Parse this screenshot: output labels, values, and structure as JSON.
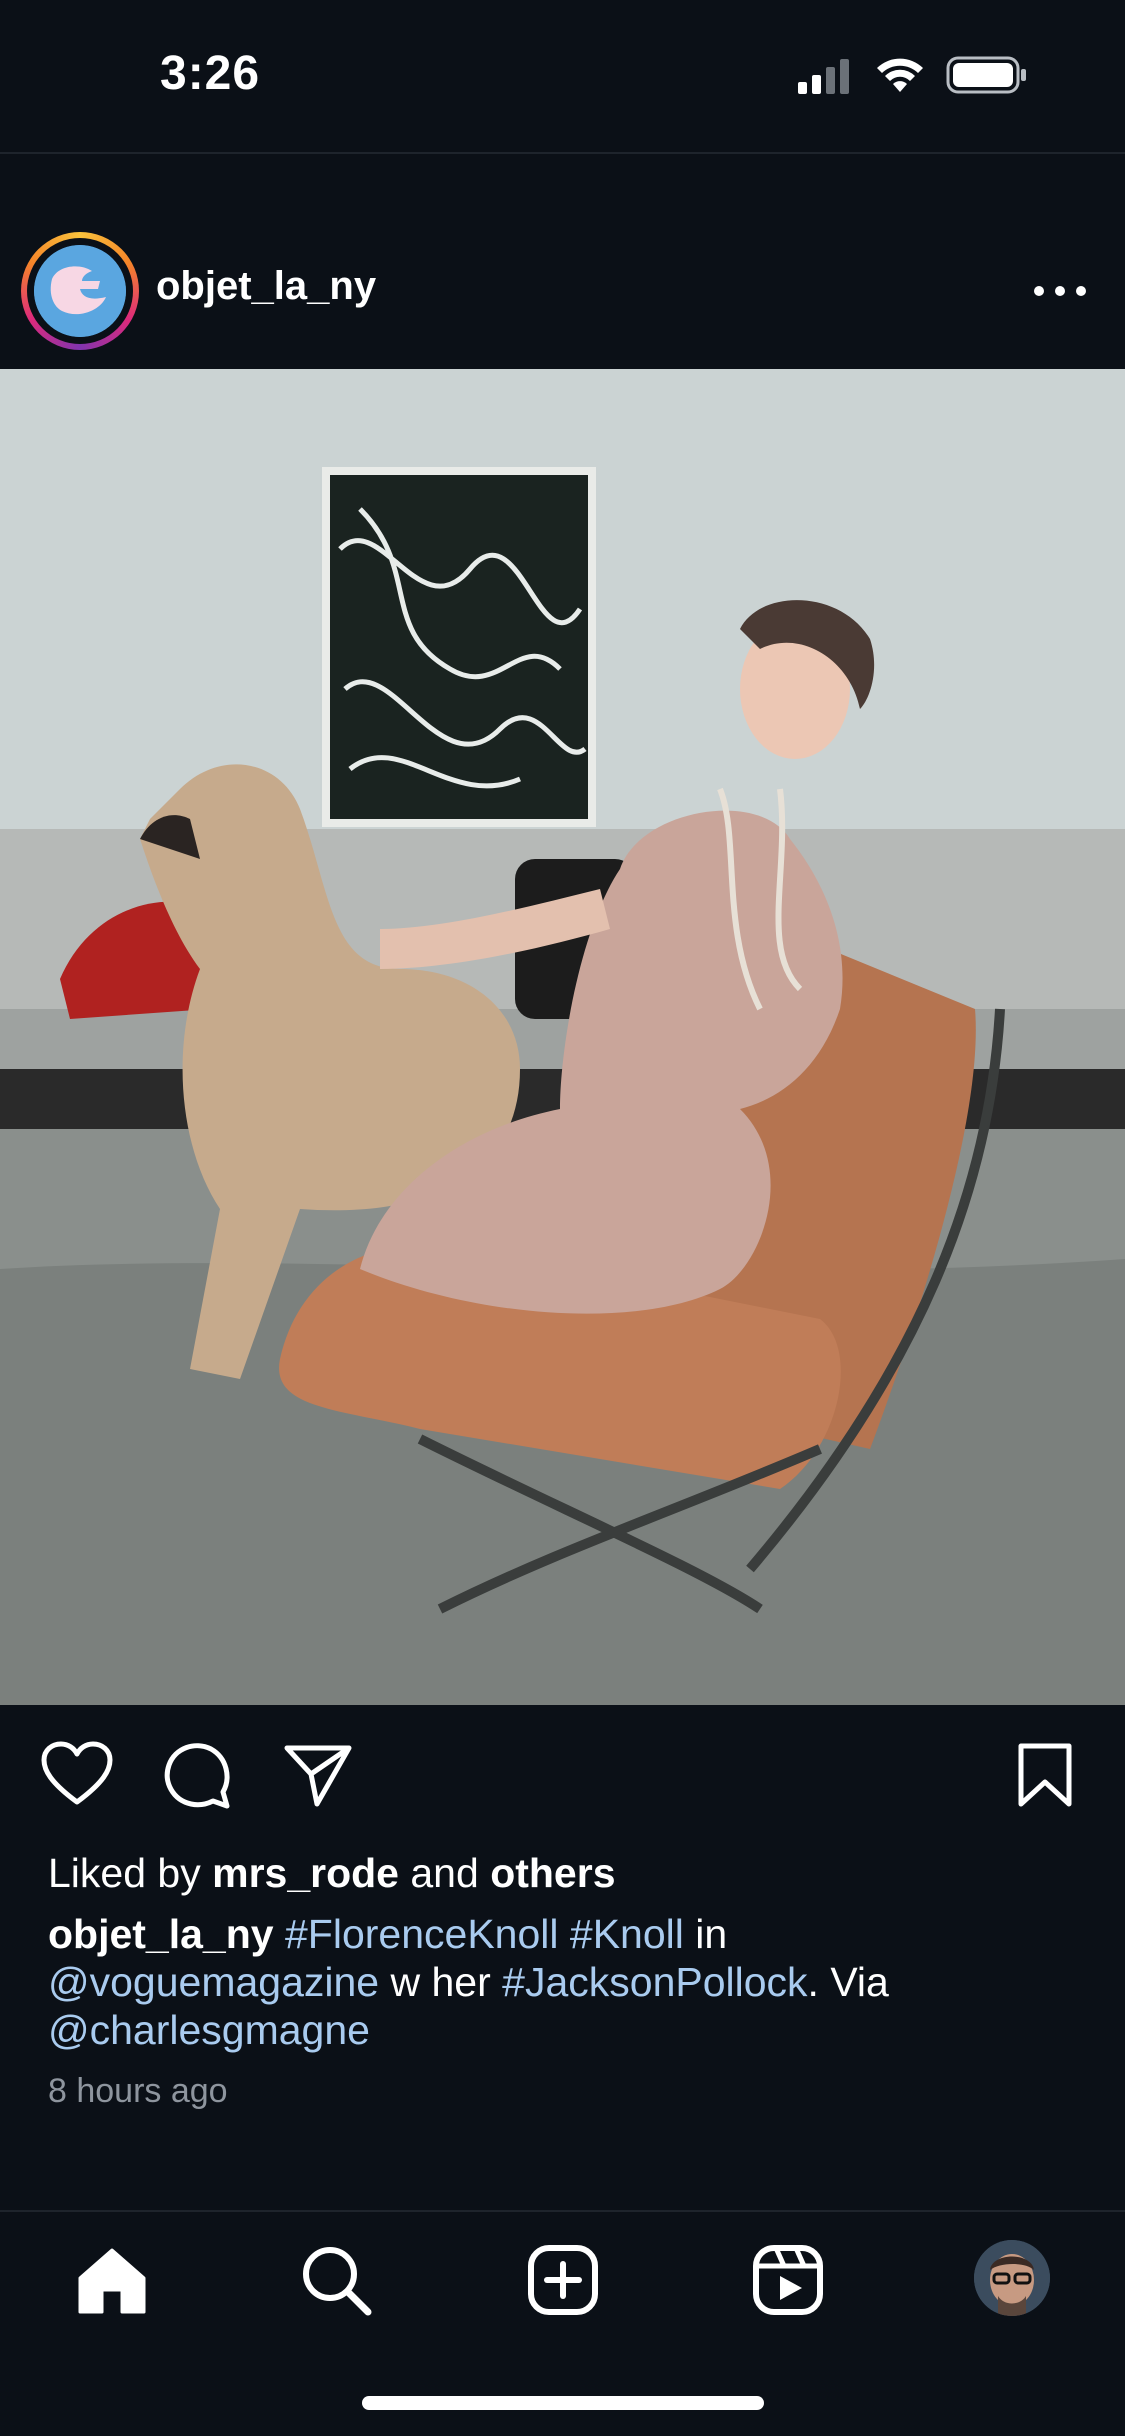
{
  "status_bar": {
    "time": "3:26"
  },
  "post": {
    "username": "objet_la_ny",
    "liked_by_prefix": "Liked by ",
    "liked_by_user": "mrs_rode",
    "liked_by_middle": " and ",
    "liked_by_others": "others",
    "caption": {
      "username": "objet_la_ny",
      "tag1": "#FlorenceKnoll",
      "tag2": "#Knoll",
      "text1": " in",
      "mention1": "@voguemagazine",
      "text2": " w her ",
      "tag3": "#JacksonPollock",
      "text3": ". Via",
      "mention2": "@charlesgmagne"
    },
    "time_ago": "8 hours ago"
  },
  "icons": {
    "signal": "signal-icon",
    "wifi": "wifi-icon",
    "battery": "battery-icon",
    "more": "more-icon",
    "like": "heart-icon",
    "comment": "comment-icon",
    "share": "share-icon",
    "save": "bookmark-icon",
    "home": "home-icon",
    "search": "search-icon",
    "add": "add-icon",
    "reels": "reels-icon",
    "profile": "profile-avatar"
  },
  "colors": {
    "background": "#0b1017",
    "link": "#a9cbef",
    "muted": "#8e959e"
  }
}
